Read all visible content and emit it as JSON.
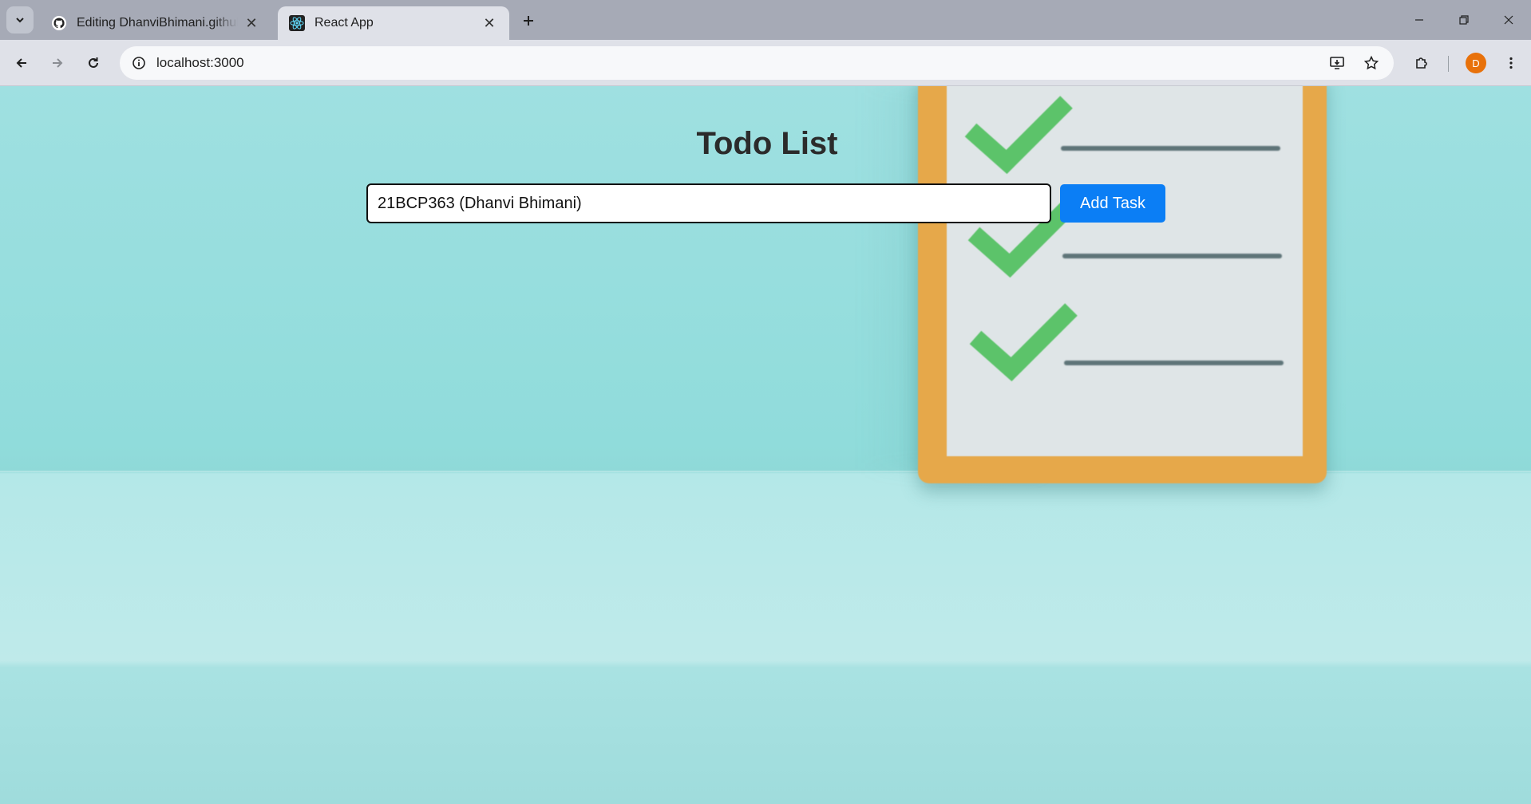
{
  "browser": {
    "tabs": [
      {
        "title": "Editing DhanviBhimani.github.io",
        "favicon": "github-icon",
        "active": false
      },
      {
        "title": "React App",
        "favicon": "react-icon",
        "active": true
      }
    ],
    "address_bar": {
      "url": "localhost:3000"
    },
    "profile": {
      "initial": "D",
      "color": "#e8710a"
    }
  },
  "app": {
    "title": "Todo List",
    "task_input": {
      "value": "21BCP363 (Dhanvi Bhimani)",
      "placeholder": ""
    },
    "add_button_label": "Add Task",
    "accent_color": "#0b7ef5"
  },
  "colors": {
    "background_wall": "#9fe0e1",
    "background_table": "#bfeaea",
    "clipboard_frame": "#e6a84a",
    "checkmark": "#5cc36a"
  }
}
